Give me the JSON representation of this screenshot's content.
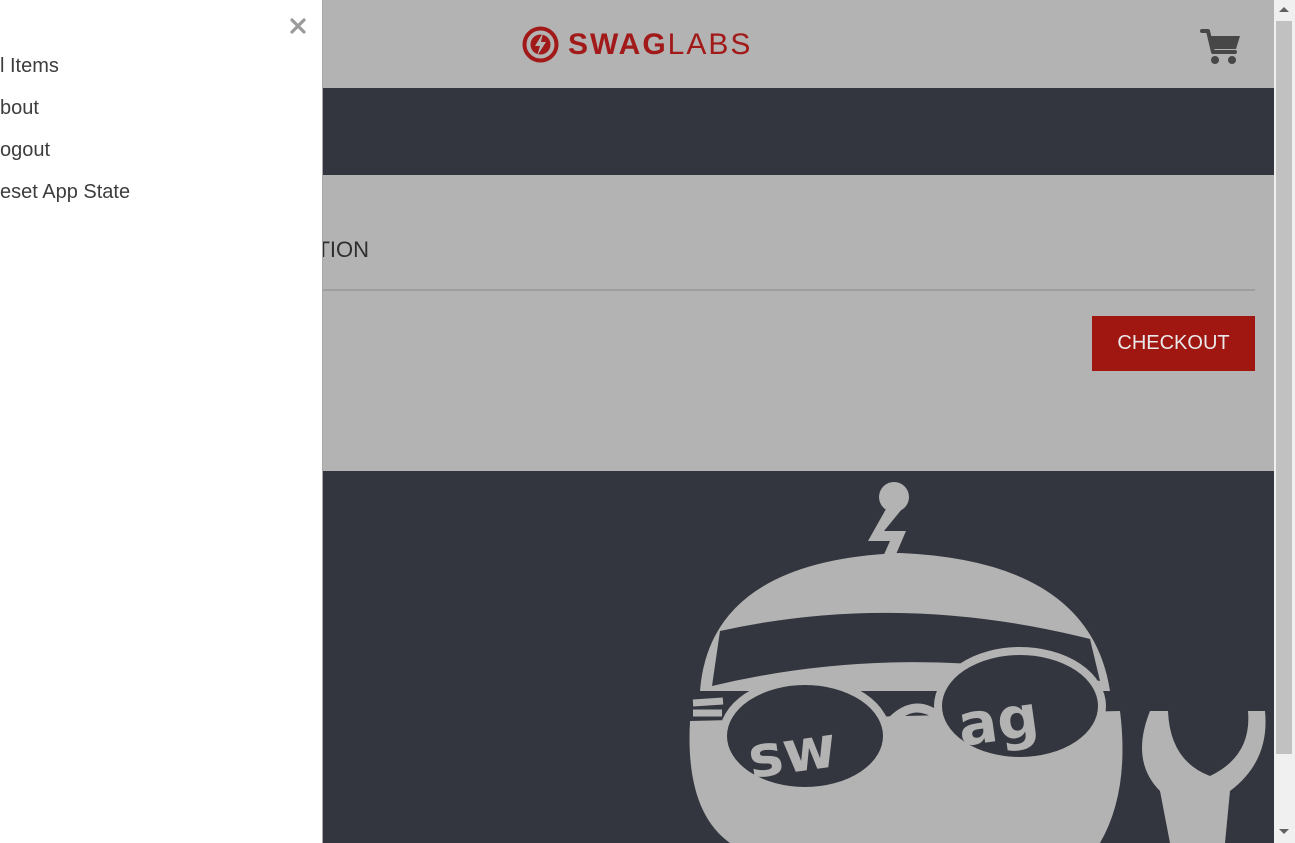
{
  "app": {
    "logo_bold": "SWAG",
    "logo_thin": "LABS",
    "brand_color": "#a11a19"
  },
  "content": {
    "title_fragment": "TION",
    "checkout_label": "CHECKOUT"
  },
  "drawer": {
    "items": [
      {
        "label": "l Items"
      },
      {
        "label": "bout"
      },
      {
        "label": "ogout"
      },
      {
        "label": "eset App State"
      }
    ]
  },
  "icons": {
    "cart": "shopping-cart-icon",
    "close": "close-icon",
    "logo": "swag-labs-logo-icon"
  },
  "colors": {
    "header_bg": "#b3b3b3",
    "dark_bg": "#33363e",
    "checkout_bg": "#a01712"
  }
}
